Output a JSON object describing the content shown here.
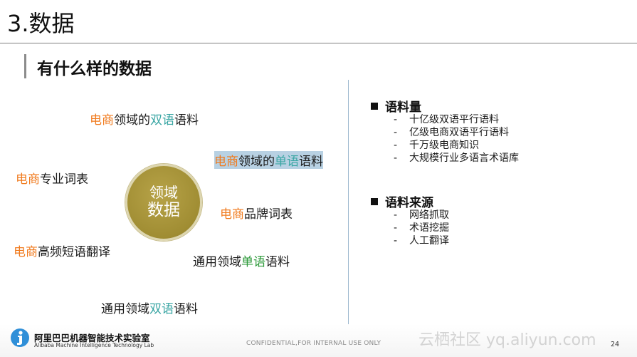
{
  "slide": {
    "title": "3.数据",
    "subtitle": "有什么样的数据",
    "page_number": "24"
  },
  "center": {
    "line1": "领域",
    "line2": "数据"
  },
  "terms": {
    "t1": {
      "a": "电商",
      "b": "领域的",
      "c": "双语",
      "d": "语料"
    },
    "t2": {
      "a": "电商",
      "b": "领域的",
      "c": "单语",
      "d": "语料"
    },
    "t3": {
      "a": "电商",
      "b": "专业词表"
    },
    "t4": {
      "a": "电商",
      "b": "品牌词表"
    },
    "t5": {
      "a": "电商",
      "b": "高频短语翻译"
    },
    "t6": {
      "a": "通用领域",
      "b": "单语",
      "c": "语料"
    },
    "t7": {
      "a": "通用领域",
      "b": "双语",
      "c": "语料"
    }
  },
  "sections": {
    "volume": {
      "heading": "语料量",
      "items": [
        "十亿级双语平行语料",
        "亿级电商双语平行语料",
        "千万级电商知识",
        "大规模行业多语言术语库"
      ]
    },
    "sources": {
      "heading": "语料来源",
      "items": [
        "网络抓取",
        "术语挖掘",
        "人工翻译"
      ]
    }
  },
  "footer": {
    "lab_name_cn": "阿里巴巴机器智能技术实验室",
    "lab_name_en": "Alibaba Machine Intelligence Technology Lab",
    "confidential": "CONFIDENTIAL,FOR INTERNAL USE ONLY",
    "watermark": "云栖社区 yq.aliyun.com"
  },
  "colors": {
    "ecommerce": "#f07a1d",
    "bilingual": "#3aa6a4",
    "monolingual": "#2e9a3b",
    "circle": "#a08d33",
    "highlight": "#b8d1e3"
  }
}
